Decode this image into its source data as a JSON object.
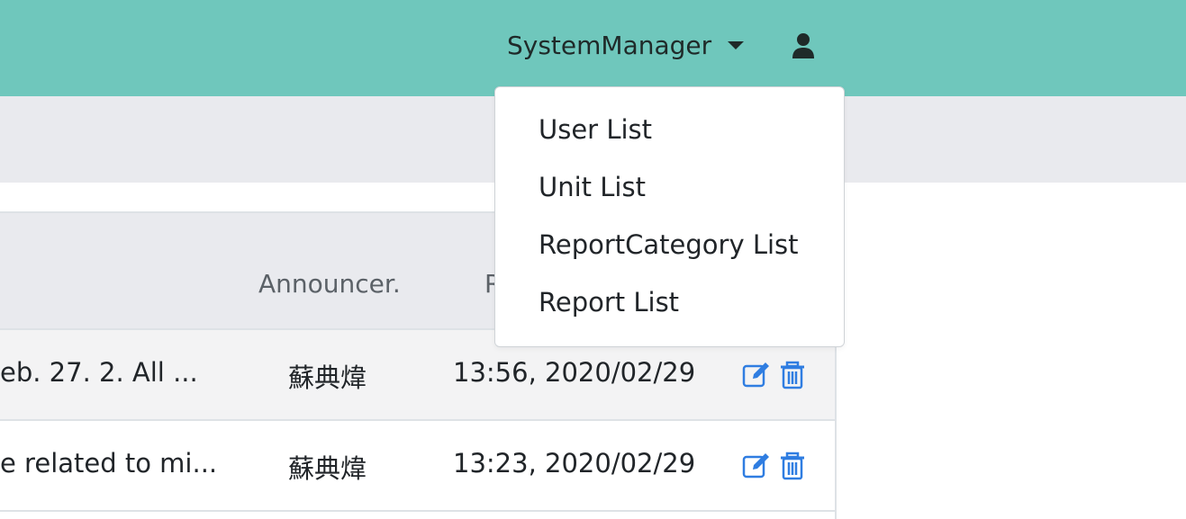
{
  "navbar": {
    "user_name": "SystemManager",
    "caret_icon": "caret-down-icon",
    "profile_icon": "user-icon",
    "color": "#6fc7bc"
  },
  "dropdown": {
    "items": [
      {
        "label": "User List"
      },
      {
        "label": "Unit List"
      },
      {
        "label": "ReportCategory List"
      },
      {
        "label": "Report List"
      }
    ]
  },
  "table": {
    "headers": {
      "announcer": "Announcer.",
      "time_partial": "R"
    },
    "rows": [
      {
        "title": "eb. 27. 2. All ...",
        "announcer": "蘇典煒",
        "time": "13:56, 2020/02/29",
        "edit_icon": "edit-icon",
        "delete_icon": "trash-icon"
      },
      {
        "title": "e related to mi...",
        "announcer": "蘇典煒",
        "time": "13:23, 2020/02/29",
        "edit_icon": "edit-icon",
        "delete_icon": "trash-icon"
      }
    ]
  },
  "colors": {
    "action_icon": "#2f7de1",
    "header_bg": "#e9eaee",
    "row_stripe": "#f3f3f4"
  }
}
